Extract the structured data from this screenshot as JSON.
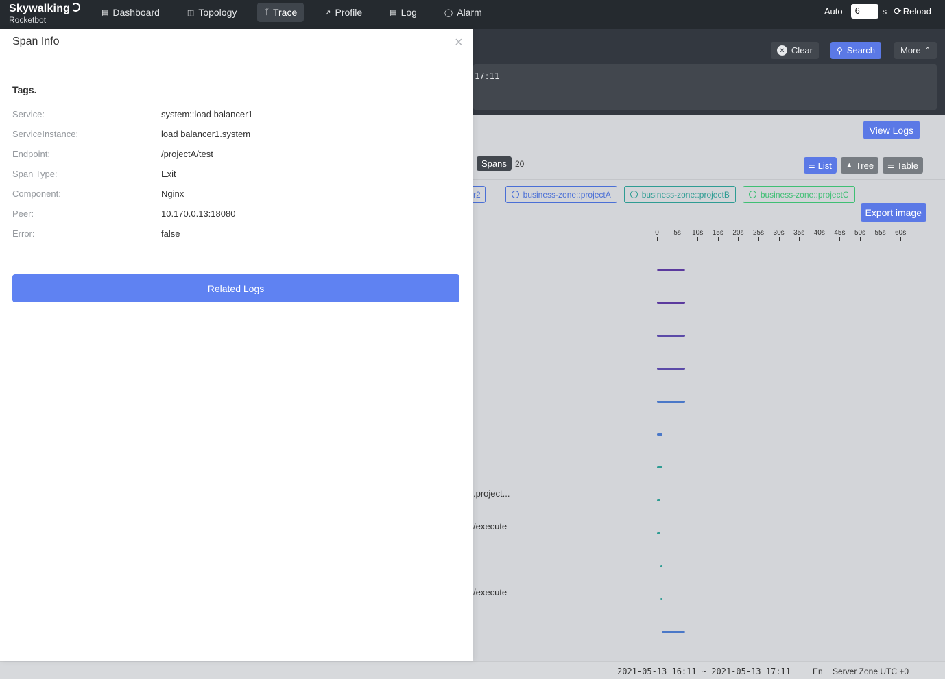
{
  "app": {
    "logo_main": "Skywalking",
    "logo_sub": "Rocketbot"
  },
  "nav": {
    "items": [
      {
        "label": "Dashboard",
        "icon": "chart-icon"
      },
      {
        "label": "Topology",
        "icon": "topology-icon"
      },
      {
        "label": "Trace",
        "icon": "trace-icon"
      },
      {
        "label": "Profile",
        "icon": "profile-icon"
      },
      {
        "label": "Log",
        "icon": "log-icon"
      },
      {
        "label": "Alarm",
        "icon": "alarm-icon"
      }
    ],
    "active": "Trace"
  },
  "auto_refresh": {
    "label": "Auto",
    "value": "6",
    "unit": "s",
    "reload": "Reload"
  },
  "search": {
    "clear": "Clear",
    "search": "Search",
    "more": "More",
    "time_fragment": "17:11"
  },
  "trace": {
    "view_logs": "View Logs",
    "spans_label": "Spans",
    "spans_count": "20",
    "views": [
      "List",
      "Tree",
      "Table"
    ],
    "active_view": "List",
    "legend": [
      {
        "label": "r2",
        "color": "#4a6fd6"
      },
      {
        "label": "business-zone::projectA",
        "color": "#4a6fd6"
      },
      {
        "label": "business-zone::projectB",
        "color": "#2e9c93"
      },
      {
        "label": "business-zone::projectC",
        "color": "#3fbf74"
      }
    ],
    "export": "Export image",
    "axis_ticks": [
      "0",
      "5s",
      "10s",
      "15s",
      "20s",
      "25s",
      "30s",
      "35s",
      "40s",
      "45s",
      "50s",
      "55s",
      "60s"
    ],
    "row_labels": [
      ".project...",
      "/execute",
      "/execute"
    ]
  },
  "span_info": {
    "title": "Span Info",
    "tags_title": "Tags.",
    "tags": [
      {
        "key": "Service:",
        "value": "system::load balancer1"
      },
      {
        "key": "ServiceInstance:",
        "value": "load balancer1.system"
      },
      {
        "key": "Endpoint:",
        "value": "/projectA/test"
      },
      {
        "key": "Span Type:",
        "value": "Exit"
      },
      {
        "key": "Component:",
        "value": "Nginx"
      },
      {
        "key": "Peer:",
        "value": "10.170.0.13:18080"
      },
      {
        "key": "Error:",
        "value": "false"
      }
    ],
    "related_logs": "Related Logs"
  },
  "footer": {
    "time_range": "2021-05-13 16:11 ~ 2021-05-13 17:11",
    "lang": "En",
    "server_zone": "Server Zone UTC +0"
  }
}
